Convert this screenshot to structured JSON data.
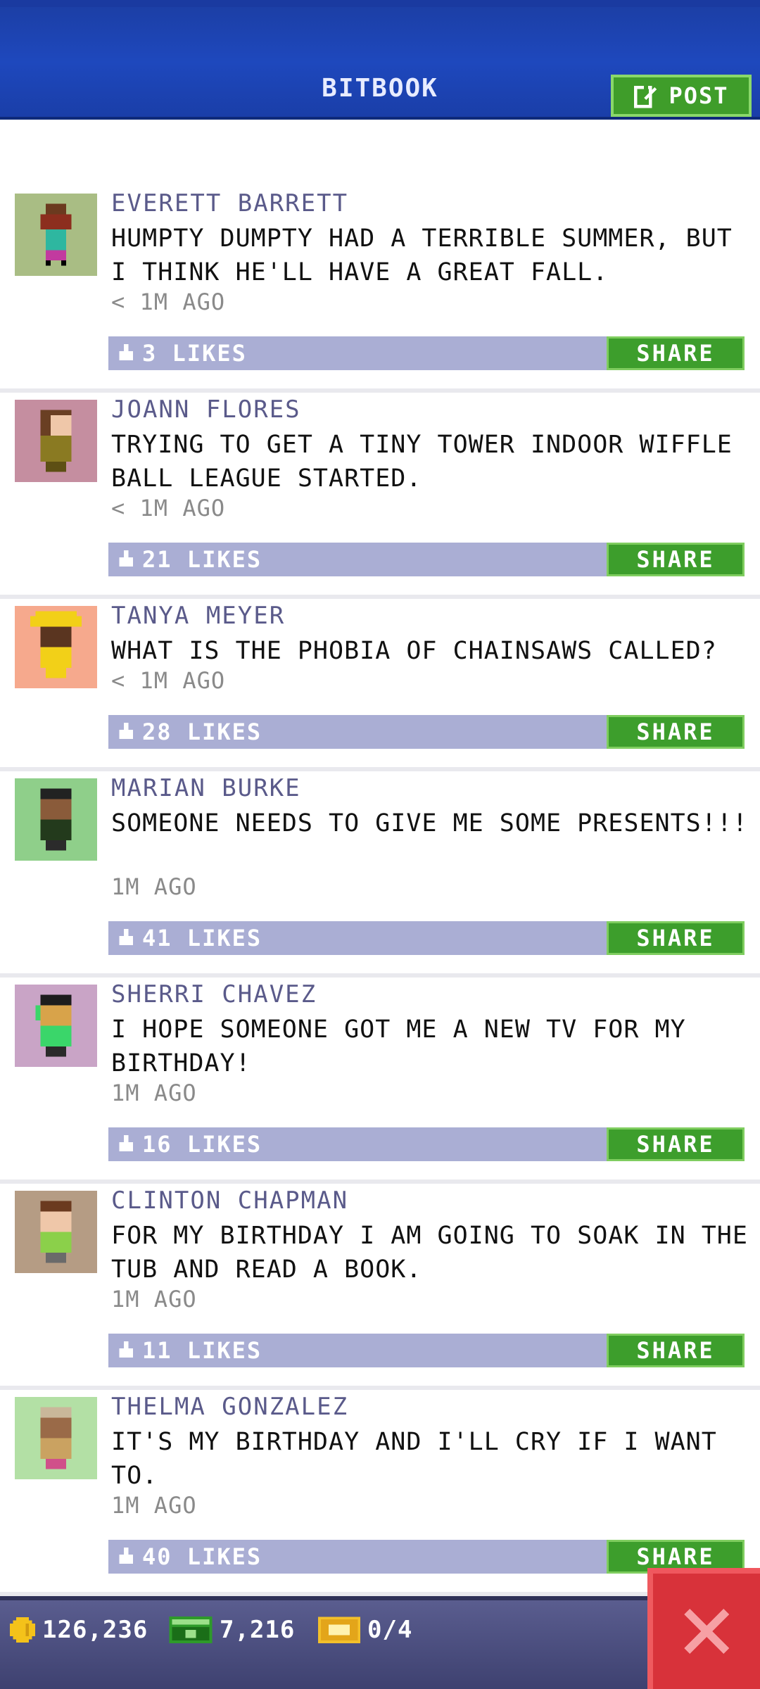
{
  "header": {
    "title": "BITBOOK",
    "post_label": "POST"
  },
  "posts": [
    {
      "name": "EVERETT BARRETT",
      "text": "HUMPTY DUMPTY HAD A TERRIBLE SUMMER, BUT I THINK HE'LL HAVE A GREAT FALL.",
      "time": "< 1M AGO",
      "likes": "3 LIKES",
      "share": "SHARE"
    },
    {
      "name": "JOANN FLORES",
      "text": "TRYING TO GET A TINY TOWER INDOOR WIFFLE BALL LEAGUE STARTED.",
      "time": "< 1M AGO",
      "likes": "21 LIKES",
      "share": "SHARE"
    },
    {
      "name": "TANYA MEYER",
      "text": "WHAT IS THE PHOBIA OF CHAINSAWS CALLED?",
      "time": "< 1M AGO",
      "likes": "28 LIKES",
      "share": "SHARE"
    },
    {
      "name": "MARIAN BURKE",
      "text": "SOMEONE NEEDS TO GIVE ME SOME PRESENTS!!!",
      "time": "1M AGO",
      "likes": "41 LIKES",
      "share": "SHARE"
    },
    {
      "name": "SHERRI CHAVEZ",
      "text": "I HOPE SOMEONE GOT ME A NEW TV FOR MY BIRTHDAY!",
      "time": "1M AGO",
      "likes": "16 LIKES",
      "share": "SHARE"
    },
    {
      "name": "CLINTON CHAPMAN",
      "text": "FOR MY BIRTHDAY I AM GOING TO SOAK IN THE TUB AND READ A BOOK.",
      "time": "1M AGO",
      "likes": "11 LIKES",
      "share": "SHARE"
    },
    {
      "name": "THELMA GONZALEZ",
      "text": "IT'S MY BIRTHDAY AND I'LL CRY IF I WANT TO.",
      "time": "1M AGO",
      "likes": "40 LIKES",
      "share": "SHARE"
    }
  ],
  "footer": {
    "coins": "126,236",
    "bux": "7,216",
    "tickets": "0/4"
  },
  "colors": {
    "header_blue": "#1e48bd",
    "share_green": "#3d9e2c",
    "like_bar": "#aaaed4",
    "name_purple": "#5a5a8a",
    "close_red": "#d8323a"
  },
  "icons": {
    "post": "edit-icon",
    "like": "thumbs-up-icon",
    "coin": "coin-icon",
    "bux": "bux-icon",
    "ticket": "ticket-icon",
    "close": "close-icon"
  }
}
